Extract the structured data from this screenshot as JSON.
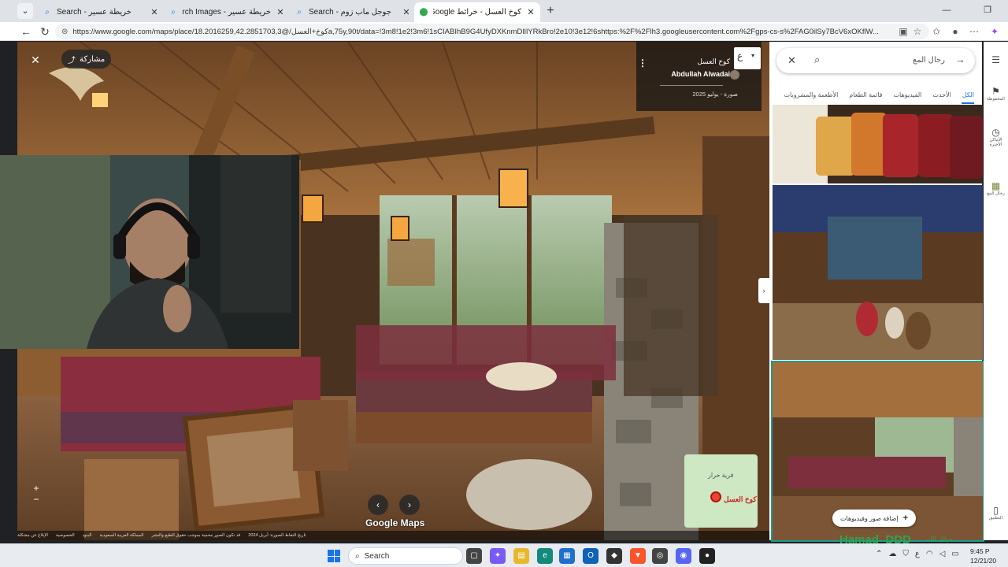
{
  "browser": {
    "tabs": [
      {
        "title": "خريطة عسير - Search",
        "active": false
      },
      {
        "title": "خريطة عسير - Search Images",
        "active": false
      },
      {
        "title": "جوجل ماب زوم - Search",
        "active": false
      },
      {
        "title": "كوخ العسل - خرائط Google",
        "active": true
      }
    ],
    "url": "https://www.google.com/maps/place/كوخ+العسل/@18.2016259,42.2851703,3a,75y,90t/data=!3m8!1e2!3m6!1sCIABIhB9G4UfyDXKnmDlIlYRkBro!2e10!3e12!6shttps:%2F%2Flh3.googleusercontent.com%2Fgps-cs-s%2FAG0ilSy7BcV6xOKflW..."
  },
  "viewer": {
    "share_label": "مشاركة",
    "place_name": "كوخ العسل",
    "author": "Abdullah Alwadai",
    "photo_date": "صورة - يوليو 2025",
    "google_maps_logo": "Google Maps",
    "minimap": {
      "label_village": "قرية خرار",
      "label_place": "كوخ العسل"
    },
    "footer": [
      "تاريخ التقاط الصورة: أبريل 2024",
      "قد تكون الصور محمية بموجب حقوق الطبع والنشر",
      "المملكة العربية السعودية",
      "البنود",
      "الخصوصية",
      "الإبلاغ عن مشكلة"
    ]
  },
  "panel": {
    "search_text": "رحال المع",
    "tabs": [
      {
        "label": "الكل",
        "active": true
      },
      {
        "label": "الأحدث",
        "active": false
      },
      {
        "label": "الفيديوهات",
        "active": false
      },
      {
        "label": "قائمة الطعام",
        "active": false
      },
      {
        "label": "الأطعمة والمشروبات",
        "active": false
      }
    ],
    "add_photo_label": "إضافة صور وفيديوهات"
  },
  "side_rail": [
    {
      "icon": "menu-icon",
      "label": ""
    },
    {
      "icon": "bookmark-icon",
      "label": "المحفوظة"
    },
    {
      "icon": "history-icon",
      "label": "الأماكن الأخيرة"
    },
    {
      "icon": "place-icon",
      "label": "رجال المع"
    },
    {
      "icon": "phone-icon",
      "label": "التطبيق"
    }
  ],
  "watermark": {
    "name": "Hamad_DDD",
    "text": "حياك الله"
  },
  "taskbar": {
    "search_label": "Search",
    "time": "9:45 P",
    "date": "12/21/20"
  }
}
